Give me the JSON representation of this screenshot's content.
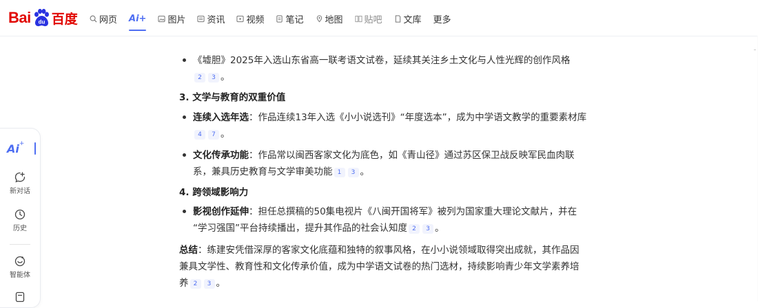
{
  "header": {
    "logo": {
      "text_left": "Bai",
      "text_paw": "du",
      "text_right": "百度"
    },
    "nav": [
      {
        "label": "网页",
        "icon": "search-icon"
      },
      {
        "label": "Ai+",
        "icon": "",
        "active": true
      },
      {
        "label": "图片",
        "icon": "image-icon"
      },
      {
        "label": "资讯",
        "icon": "news-icon"
      },
      {
        "label": "视频",
        "icon": "video-icon"
      },
      {
        "label": "笔记",
        "icon": "note-icon"
      },
      {
        "label": "地图",
        "icon": "map-icon"
      },
      {
        "label": "贴吧",
        "icon": "tieba-icon",
        "disabled": true
      },
      {
        "label": "文库",
        "icon": "doc-icon"
      },
      {
        "label": "更多",
        "icon": ""
      }
    ]
  },
  "sidebar": {
    "ai_label": "Ai",
    "ai_star": "+",
    "items": [
      {
        "label": "新对话",
        "icon": "new-chat-icon"
      },
      {
        "label": "历史",
        "icon": "history-icon"
      },
      {
        "label": "智能体",
        "icon": "agent-icon"
      }
    ]
  },
  "content": {
    "b1": {
      "text": "《墟胆》2025年入选山东省高一联考语文试卷，延续其关注乡土文化与人性光辉的创作风格",
      "cites": [
        "2",
        "3"
      ],
      "end": "。"
    },
    "h3": "3. 文学与教育的双重价值",
    "b2": {
      "strong": "连续入选年选",
      "text": "：作品连续13年入选《小小说选刊》“年度选本”，成为中学语文教学的重要素材库",
      "cites": [
        "4",
        "7"
      ],
      "end": "。"
    },
    "b3": {
      "strong": "文化传承功能",
      "text1": "：作品常以闽西客家文化为底色，如《青山径》通过苏区保卫战反映军民血肉联",
      "text2": "系，兼具历史教育与文学审美功能",
      "cites": [
        "1",
        "3"
      ],
      "end": "。"
    },
    "h4": "4. 跨领域影响力",
    "b4": {
      "strong": "影视创作延伸",
      "text1": "：担任总撰稿的50集电视片《八闽开国将军》被列为国家重大理论文献片，并在",
      "text2": "“学习强国”平台持续播出，提升其作品的社会认知度",
      "cites": [
        "2",
        "3"
      ],
      "end": "。"
    },
    "summary": {
      "strong": "总结",
      "line1": "：练建安凭借深厚的客家文化底蕴和独特的叙事风格，在小小说领域取得突出成就，其作品因",
      "line2": "兼具文学性、教育性和文化传承价值，成为中学语文试卷的热门选材，持续影响青少年文学素养培",
      "line3": "养",
      "cites": [
        "2",
        "3"
      ],
      "end": "。"
    }
  },
  "colors": {
    "brand_red": "#e10601",
    "accent_blue": "#4e6ef2"
  }
}
